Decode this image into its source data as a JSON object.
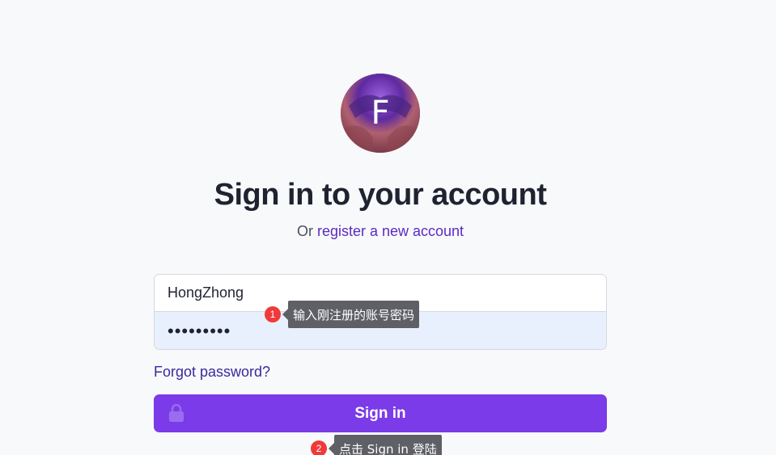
{
  "header": {
    "logo_letter": "F",
    "title": "Sign in to your account",
    "subtitle_prefix": "Or",
    "register_link": "register a new account"
  },
  "form": {
    "username_value": "HongZhong",
    "password_value": "•••••••••",
    "forgot_label": "Forgot password?",
    "signin_label": "Sign in"
  },
  "annotations": [
    {
      "number": "1",
      "text": "输入刚注册的账号密码"
    },
    {
      "number": "2",
      "text": "点击 Sign in 登陆"
    }
  ],
  "colors": {
    "accent": "#7b3be8",
    "link": "#5b2bc2",
    "badge": "#f03a3a",
    "tooltip_bg": "#5e6066"
  }
}
